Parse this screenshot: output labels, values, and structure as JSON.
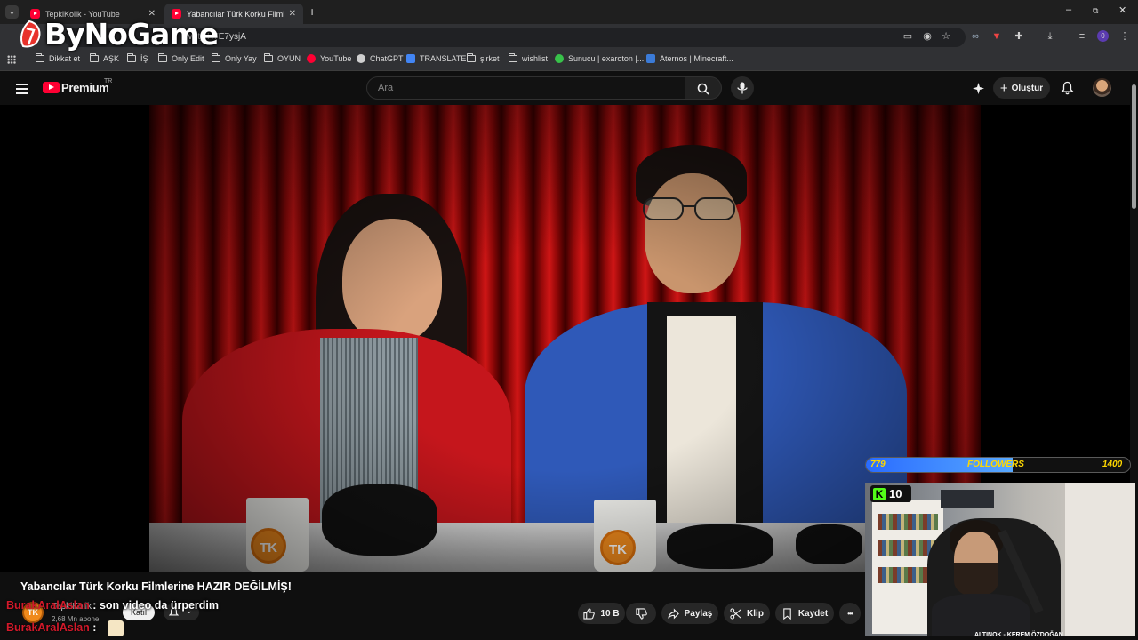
{
  "browser": {
    "tabs": [
      {
        "label": "TepkiKolik - YouTube",
        "active": false
      },
      {
        "label": "Yabancılar Türk Korku Filmlerine",
        "active": true
      }
    ],
    "new_tab_symbol": "+",
    "url": "?v=tj4H7E7ysjA",
    "window_controls": {
      "minimize": "–",
      "maximize": "⧉",
      "close": "✕"
    },
    "profile_badge": "0",
    "bookmarks": [
      {
        "label": "Dikkat et",
        "icon": "folder-icon"
      },
      {
        "label": "AŞK",
        "icon": "folder-icon"
      },
      {
        "label": "İŞ",
        "icon": "folder-icon"
      },
      {
        "label": "Only Edit",
        "icon": "folder-icon"
      },
      {
        "label": "Only Yay",
        "icon": "folder-icon"
      },
      {
        "label": "OYUN",
        "icon": "folder-icon"
      },
      {
        "label": "YouTube",
        "icon": "youtube-icon"
      },
      {
        "label": "ChatGPT",
        "icon": "chatgpt-icon"
      },
      {
        "label": "TRANSLATE",
        "icon": "translate-icon"
      },
      {
        "label": "şirket",
        "icon": "folder-icon"
      },
      {
        "label": "wishlist",
        "icon": "folder-icon"
      },
      {
        "label": "Sunucu | exaroton |...",
        "icon": "exaroton-icon"
      },
      {
        "label": "Aternos | Minecraft...",
        "icon": "aternos-icon"
      }
    ]
  },
  "watermark": {
    "text": "ByNoGame"
  },
  "youtube": {
    "brand": "Premium",
    "region": "TR",
    "search_placeholder": "Ara",
    "create_label": "Oluştur"
  },
  "video": {
    "title": "Yabancılar Türk Korku Filmlerine HAZIR DEĞİLMİŞ!",
    "mug_logo": "TK",
    "channel": {
      "name": "TepkiKolik",
      "subscribers": "2,68 Mn abone",
      "join_label": "Katıl"
    },
    "actions": {
      "likes": "10 B",
      "share": "Paylaş",
      "clip": "Klip",
      "save": "Kaydet",
      "more": "•••"
    }
  },
  "chat": [
    {
      "name": "BurakAralAslan",
      "sep": ":",
      "message": "son video da ürperdim"
    },
    {
      "name": "BurakAralAslan",
      "sep": ":",
      "message": ""
    }
  ],
  "stream_overlay": {
    "followers_current": "779",
    "followers_label": "FOLLOWERS",
    "followers_goal": "1400",
    "followers_progress": 0.556,
    "kick_logo": "K",
    "kick_viewers": "10",
    "ticker": "ALTINOK - KEREM ÖZDOĞAN"
  },
  "colors": {
    "yt_red": "#ff0033",
    "chat_name": "#d3192a",
    "goal_text": "#ffd800",
    "kick_green": "#53fc18"
  }
}
